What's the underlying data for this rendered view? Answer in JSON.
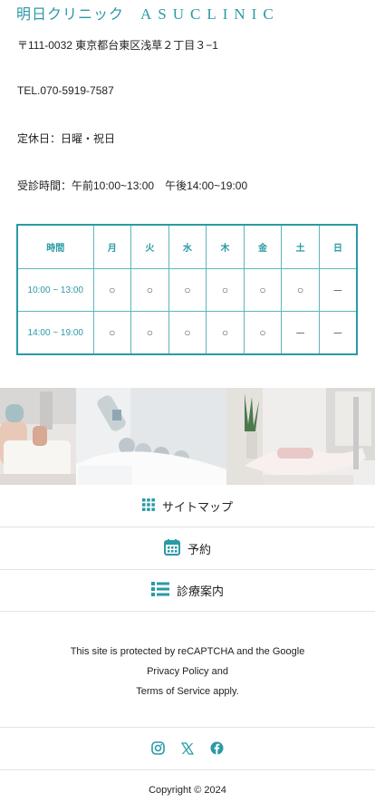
{
  "header": {
    "logo_jp": "明日クリニック",
    "logo_en": "ASUCLINIC"
  },
  "clinic": {
    "address": "〒111-0032 東京都台東区浅草２丁目３−1",
    "tel": "TEL.070-5919-7587",
    "holiday": "定休日：日曜・祝日",
    "hours": "受診時間：午前10:00~13:00　午後14:00~19:00"
  },
  "schedule": {
    "header": [
      "時間",
      "月",
      "火",
      "水",
      "木",
      "金",
      "土",
      "日"
    ],
    "rows": [
      {
        "time": "10:00 ~ 13:00",
        "marks": [
          "○",
          "○",
          "○",
          "○",
          "○",
          "○",
          "－"
        ]
      },
      {
        "time": "14:00 ~ 19:00",
        "marks": [
          "○",
          "○",
          "○",
          "○",
          "○",
          "－",
          "－"
        ]
      }
    ]
  },
  "nav": {
    "sitemap": "サイトマップ",
    "reserve": "予約",
    "guide": "診療案内"
  },
  "recaptcha": {
    "line1": "This site is protected by reCAPTCHA and the Google",
    "line2": "Privacy Policy and",
    "line3": "Terms of Service apply."
  },
  "social": {
    "icons": [
      "instagram-icon",
      "x-icon",
      "facebook-icon"
    ]
  },
  "footer": {
    "copyright": "Copyright © 2024"
  },
  "colors": {
    "accent": "#2a9aa6"
  }
}
